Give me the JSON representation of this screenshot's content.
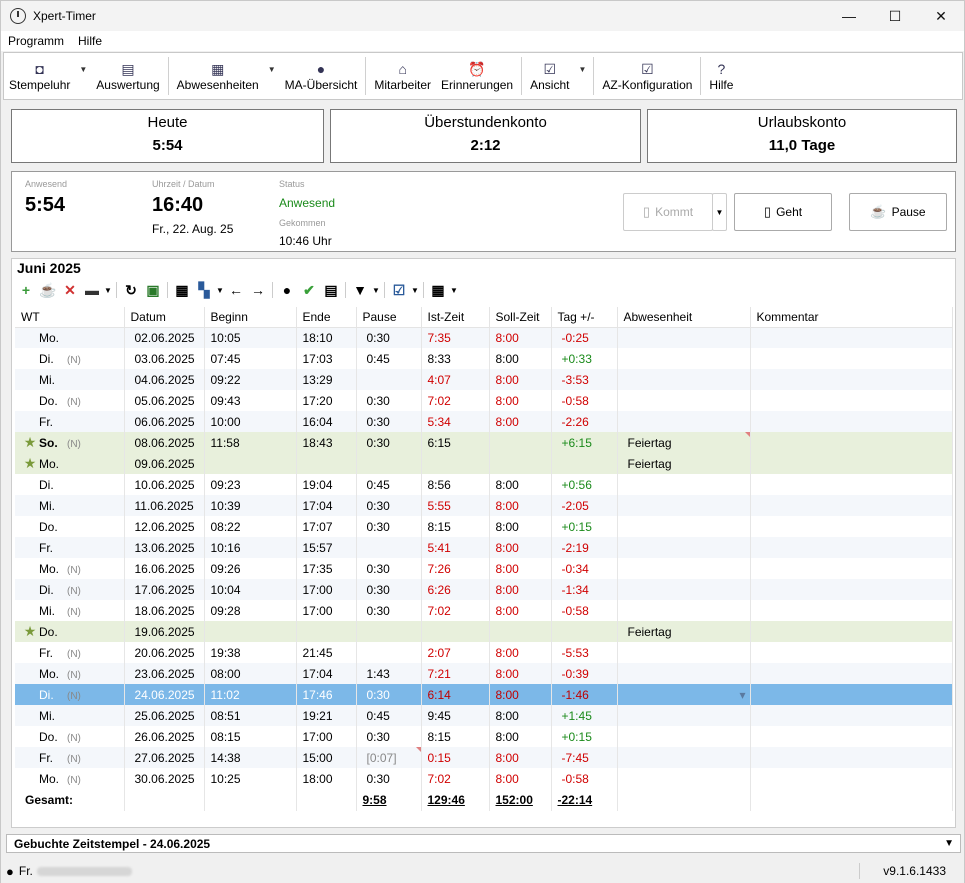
{
  "window": {
    "title": "Xpert-Timer",
    "minimize": "—",
    "maximize": "☐",
    "close": "✕"
  },
  "menu": [
    "Programm",
    "Hilfe"
  ],
  "toolbar": {
    "stempeluhr": "Stempeluhr",
    "auswertung": "Auswertung",
    "abwesenheiten": "Abwesenheiten",
    "ma_uebersicht": "MA-Übersicht",
    "mitarbeiter": "Mitarbeiter",
    "erinnerungen": "Erinnerungen",
    "ansicht": "Ansicht",
    "az_konfiguration": "AZ-Konfiguration",
    "hilfe": "Hilfe"
  },
  "summary": {
    "heute": {
      "title": "Heute",
      "value": "5:54"
    },
    "ueberstunden": {
      "title": "Überstundenkonto",
      "value": "2:12"
    },
    "urlaub": {
      "title": "Urlaubskonto",
      "value": "11,0 Tage"
    }
  },
  "status": {
    "anwesend_label": "Anwesend",
    "anwesend_value": "5:54",
    "uhrzeit_label": "Uhrzeit / Datum",
    "uhrzeit_value": "16:40",
    "datum_value": "Fr., 22. Aug. 25",
    "status_label": "Status",
    "status_value": "Anwesend",
    "gekommen_label": "Gekommen",
    "gekommen_value": "10:46 Uhr",
    "kommt_button": "Kommt",
    "geht_button": "Geht",
    "pause_button": "Pause"
  },
  "month": {
    "title": "Juni 2025"
  },
  "columns": [
    "WT",
    "Datum",
    "Beginn",
    "Ende",
    "Pause",
    "Ist-Zeit",
    "Soll-Zeit",
    "Tag +/-",
    "Abwesenheit",
    "Kommentar"
  ],
  "rows": [
    {
      "wt": "Mo.",
      "n": "",
      "datum": "02.06.2025",
      "beginn": "10:05",
      "ende": "18:10",
      "pause": "0:30",
      "ist": "7:35",
      "ist_red": true,
      "soll": "8:00",
      "tag": "-0:25",
      "abw": "",
      "type": ""
    },
    {
      "wt": "Di.",
      "n": "(N)",
      "datum": "03.06.2025",
      "beginn": "07:45",
      "ende": "17:03",
      "pause": "0:45",
      "ist": "8:33",
      "ist_red": false,
      "soll": "8:00",
      "tag": "+0:33",
      "abw": "",
      "type": ""
    },
    {
      "wt": "Mi.",
      "n": "",
      "datum": "04.06.2025",
      "beginn": "09:22",
      "ende": "13:29",
      "pause": "",
      "ist": "4:07",
      "ist_red": true,
      "soll": "8:00",
      "tag": "-3:53",
      "abw": "",
      "type": ""
    },
    {
      "wt": "Do.",
      "n": "(N)",
      "datum": "05.06.2025",
      "beginn": "09:43",
      "ende": "17:20",
      "pause": "0:30",
      "ist": "7:02",
      "ist_red": true,
      "soll": "8:00",
      "tag": "-0:58",
      "abw": "",
      "type": ""
    },
    {
      "wt": "Fr.",
      "n": "",
      "datum": "06.06.2025",
      "beginn": "10:00",
      "ende": "16:04",
      "pause": "0:30",
      "ist": "5:34",
      "ist_red": true,
      "soll": "8:00",
      "tag": "-2:26",
      "abw": "",
      "type": ""
    },
    {
      "wt": "So.",
      "n": "(N)",
      "datum": "08.06.2025",
      "beginn": "11:58",
      "ende": "18:43",
      "pause": "0:30",
      "ist": "6:15",
      "ist_red": false,
      "soll": "",
      "tag": "+6:15",
      "abw": "Feiertag",
      "type": "hol",
      "bold": true
    },
    {
      "wt": "Mo.",
      "n": "",
      "datum": "09.06.2025",
      "beginn": "",
      "ende": "",
      "pause": "",
      "ist": "",
      "ist_red": false,
      "soll": "",
      "tag": "",
      "abw": "Feiertag",
      "type": "hol"
    },
    {
      "wt": "Di.",
      "n": "",
      "datum": "10.06.2025",
      "beginn": "09:23",
      "ende": "19:04",
      "pause": "0:45",
      "ist": "8:56",
      "ist_red": false,
      "soll": "8:00",
      "tag": "+0:56",
      "abw": "",
      "type": ""
    },
    {
      "wt": "Mi.",
      "n": "",
      "datum": "11.06.2025",
      "beginn": "10:39",
      "ende": "17:04",
      "pause": "0:30",
      "ist": "5:55",
      "ist_red": true,
      "soll": "8:00",
      "tag": "-2:05",
      "abw": "",
      "type": ""
    },
    {
      "wt": "Do.",
      "n": "",
      "datum": "12.06.2025",
      "beginn": "08:22",
      "ende": "17:07",
      "pause": "0:30",
      "ist": "8:15",
      "ist_red": false,
      "soll": "8:00",
      "tag": "+0:15",
      "abw": "",
      "type": ""
    },
    {
      "wt": "Fr.",
      "n": "",
      "datum": "13.06.2025",
      "beginn": "10:16",
      "ende": "15:57",
      "pause": "",
      "ist": "5:41",
      "ist_red": true,
      "soll": "8:00",
      "tag": "-2:19",
      "abw": "",
      "type": ""
    },
    {
      "wt": "Mo.",
      "n": "(N)",
      "datum": "16.06.2025",
      "beginn": "09:26",
      "ende": "17:35",
      "pause": "0:30",
      "ist": "7:26",
      "ist_red": true,
      "soll": "8:00",
      "tag": "-0:34",
      "abw": "",
      "type": ""
    },
    {
      "wt": "Di.",
      "n": "(N)",
      "datum": "17.06.2025",
      "beginn": "10:04",
      "ende": "17:00",
      "pause": "0:30",
      "ist": "6:26",
      "ist_red": true,
      "soll": "8:00",
      "tag": "-1:34",
      "abw": "",
      "type": ""
    },
    {
      "wt": "Mi.",
      "n": "(N)",
      "datum": "18.06.2025",
      "beginn": "09:28",
      "ende": "17:00",
      "pause": "0:30",
      "ist": "7:02",
      "ist_red": true,
      "soll": "8:00",
      "tag": "-0:58",
      "abw": "",
      "type": ""
    },
    {
      "wt": "Do.",
      "n": "",
      "datum": "19.06.2025",
      "beginn": "",
      "ende": "",
      "pause": "",
      "ist": "",
      "ist_red": false,
      "soll": "",
      "tag": "",
      "abw": "Feiertag",
      "type": "hol"
    },
    {
      "wt": "Fr.",
      "n": "(N)",
      "datum": "20.06.2025",
      "beginn": "19:38",
      "ende": "21:45",
      "pause": "",
      "ist": "2:07",
      "ist_red": true,
      "soll": "8:00",
      "tag": "-5:53",
      "abw": "",
      "type": ""
    },
    {
      "wt": "Mo.",
      "n": "(N)",
      "datum": "23.06.2025",
      "beginn": "08:00",
      "ende": "17:04",
      "pause": "1:43",
      "ist": "7:21",
      "ist_red": true,
      "soll": "8:00",
      "tag": "-0:39",
      "abw": "",
      "type": ""
    },
    {
      "wt": "Di.",
      "n": "(N)",
      "datum": "24.06.2025",
      "beginn": "11:02",
      "ende": "17:46",
      "pause": "0:30",
      "ist": "6:14",
      "ist_red": true,
      "soll": "8:00",
      "tag": "-1:46",
      "abw": "",
      "type": "sel"
    },
    {
      "wt": "Mi.",
      "n": "",
      "datum": "25.06.2025",
      "beginn": "08:51",
      "ende": "19:21",
      "pause": "0:45",
      "ist": "9:45",
      "ist_red": false,
      "soll": "8:00",
      "tag": "+1:45",
      "abw": "",
      "type": ""
    },
    {
      "wt": "Do.",
      "n": "(N)",
      "datum": "26.06.2025",
      "beginn": "08:15",
      "ende": "17:00",
      "pause": "0:30",
      "ist": "8:15",
      "ist_red": false,
      "soll": "8:00",
      "tag": "+0:15",
      "abw": "",
      "type": ""
    },
    {
      "wt": "Fr.",
      "n": "(N)",
      "datum": "27.06.2025",
      "beginn": "14:38",
      "ende": "15:00",
      "pause": "[0:07]",
      "ist": "0:15",
      "ist_red": true,
      "soll": "8:00",
      "tag": "-7:45",
      "abw": "",
      "type": ""
    },
    {
      "wt": "Mo.",
      "n": "(N)",
      "datum": "30.06.2025",
      "beginn": "10:25",
      "ende": "18:00",
      "pause": "0:30",
      "ist": "7:02",
      "ist_red": true,
      "soll": "8:00",
      "tag": "-0:58",
      "abw": "",
      "type": ""
    }
  ],
  "totals": {
    "label": "Gesamt:",
    "pause": "9:58",
    "ist": "129:46",
    "soll": "152:00",
    "tag": "-22:14"
  },
  "subpanel": {
    "title": "Gebuchte Zeitstempel - 24.06.2025"
  },
  "statusbar": {
    "user_prefix": "Fr.",
    "version": "v9.1.6.1433"
  },
  "colors": {
    "holiday_row": "#e8f0dc",
    "selected_row": "#7cb8e8",
    "negative": "#d00000",
    "positive": "#1a8a1a"
  }
}
